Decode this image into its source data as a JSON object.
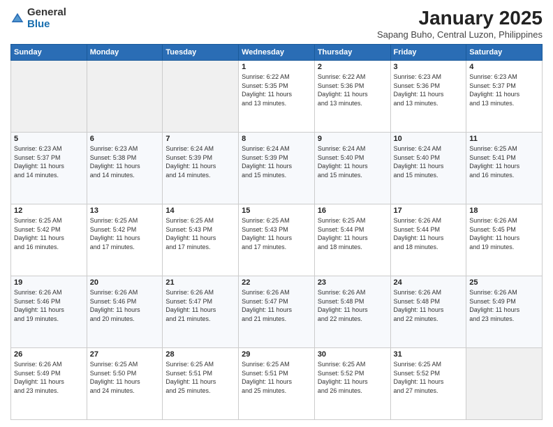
{
  "logo": {
    "general": "General",
    "blue": "Blue"
  },
  "header": {
    "month": "January 2025",
    "location": "Sapang Buho, Central Luzon, Philippines"
  },
  "weekdays": [
    "Sunday",
    "Monday",
    "Tuesday",
    "Wednesday",
    "Thursday",
    "Friday",
    "Saturday"
  ],
  "weeks": [
    [
      {
        "day": "",
        "info": ""
      },
      {
        "day": "",
        "info": ""
      },
      {
        "day": "",
        "info": ""
      },
      {
        "day": "1",
        "info": "Sunrise: 6:22 AM\nSunset: 5:35 PM\nDaylight: 11 hours\nand 13 minutes."
      },
      {
        "day": "2",
        "info": "Sunrise: 6:22 AM\nSunset: 5:36 PM\nDaylight: 11 hours\nand 13 minutes."
      },
      {
        "day": "3",
        "info": "Sunrise: 6:23 AM\nSunset: 5:36 PM\nDaylight: 11 hours\nand 13 minutes."
      },
      {
        "day": "4",
        "info": "Sunrise: 6:23 AM\nSunset: 5:37 PM\nDaylight: 11 hours\nand 13 minutes."
      }
    ],
    [
      {
        "day": "5",
        "info": "Sunrise: 6:23 AM\nSunset: 5:37 PM\nDaylight: 11 hours\nand 14 minutes."
      },
      {
        "day": "6",
        "info": "Sunrise: 6:23 AM\nSunset: 5:38 PM\nDaylight: 11 hours\nand 14 minutes."
      },
      {
        "day": "7",
        "info": "Sunrise: 6:24 AM\nSunset: 5:39 PM\nDaylight: 11 hours\nand 14 minutes."
      },
      {
        "day": "8",
        "info": "Sunrise: 6:24 AM\nSunset: 5:39 PM\nDaylight: 11 hours\nand 15 minutes."
      },
      {
        "day": "9",
        "info": "Sunrise: 6:24 AM\nSunset: 5:40 PM\nDaylight: 11 hours\nand 15 minutes."
      },
      {
        "day": "10",
        "info": "Sunrise: 6:24 AM\nSunset: 5:40 PM\nDaylight: 11 hours\nand 15 minutes."
      },
      {
        "day": "11",
        "info": "Sunrise: 6:25 AM\nSunset: 5:41 PM\nDaylight: 11 hours\nand 16 minutes."
      }
    ],
    [
      {
        "day": "12",
        "info": "Sunrise: 6:25 AM\nSunset: 5:42 PM\nDaylight: 11 hours\nand 16 minutes."
      },
      {
        "day": "13",
        "info": "Sunrise: 6:25 AM\nSunset: 5:42 PM\nDaylight: 11 hours\nand 17 minutes."
      },
      {
        "day": "14",
        "info": "Sunrise: 6:25 AM\nSunset: 5:43 PM\nDaylight: 11 hours\nand 17 minutes."
      },
      {
        "day": "15",
        "info": "Sunrise: 6:25 AM\nSunset: 5:43 PM\nDaylight: 11 hours\nand 17 minutes."
      },
      {
        "day": "16",
        "info": "Sunrise: 6:25 AM\nSunset: 5:44 PM\nDaylight: 11 hours\nand 18 minutes."
      },
      {
        "day": "17",
        "info": "Sunrise: 6:26 AM\nSunset: 5:44 PM\nDaylight: 11 hours\nand 18 minutes."
      },
      {
        "day": "18",
        "info": "Sunrise: 6:26 AM\nSunset: 5:45 PM\nDaylight: 11 hours\nand 19 minutes."
      }
    ],
    [
      {
        "day": "19",
        "info": "Sunrise: 6:26 AM\nSunset: 5:46 PM\nDaylight: 11 hours\nand 19 minutes."
      },
      {
        "day": "20",
        "info": "Sunrise: 6:26 AM\nSunset: 5:46 PM\nDaylight: 11 hours\nand 20 minutes."
      },
      {
        "day": "21",
        "info": "Sunrise: 6:26 AM\nSunset: 5:47 PM\nDaylight: 11 hours\nand 21 minutes."
      },
      {
        "day": "22",
        "info": "Sunrise: 6:26 AM\nSunset: 5:47 PM\nDaylight: 11 hours\nand 21 minutes."
      },
      {
        "day": "23",
        "info": "Sunrise: 6:26 AM\nSunset: 5:48 PM\nDaylight: 11 hours\nand 22 minutes."
      },
      {
        "day": "24",
        "info": "Sunrise: 6:26 AM\nSunset: 5:48 PM\nDaylight: 11 hours\nand 22 minutes."
      },
      {
        "day": "25",
        "info": "Sunrise: 6:26 AM\nSunset: 5:49 PM\nDaylight: 11 hours\nand 23 minutes."
      }
    ],
    [
      {
        "day": "26",
        "info": "Sunrise: 6:26 AM\nSunset: 5:49 PM\nDaylight: 11 hours\nand 23 minutes."
      },
      {
        "day": "27",
        "info": "Sunrise: 6:25 AM\nSunset: 5:50 PM\nDaylight: 11 hours\nand 24 minutes."
      },
      {
        "day": "28",
        "info": "Sunrise: 6:25 AM\nSunset: 5:51 PM\nDaylight: 11 hours\nand 25 minutes."
      },
      {
        "day": "29",
        "info": "Sunrise: 6:25 AM\nSunset: 5:51 PM\nDaylight: 11 hours\nand 25 minutes."
      },
      {
        "day": "30",
        "info": "Sunrise: 6:25 AM\nSunset: 5:52 PM\nDaylight: 11 hours\nand 26 minutes."
      },
      {
        "day": "31",
        "info": "Sunrise: 6:25 AM\nSunset: 5:52 PM\nDaylight: 11 hours\nand 27 minutes."
      },
      {
        "day": "",
        "info": ""
      }
    ]
  ]
}
